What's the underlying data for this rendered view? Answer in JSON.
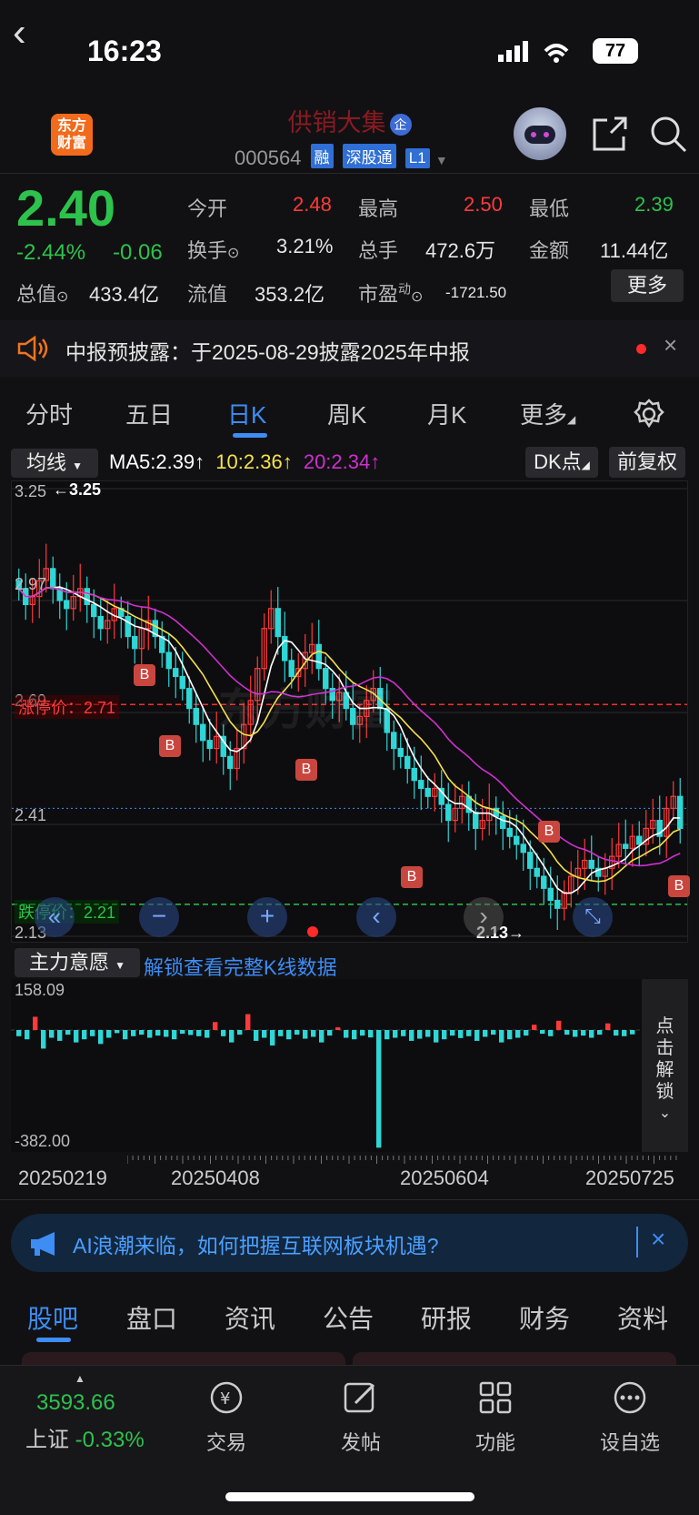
{
  "status": {
    "time": "16:23",
    "battery": "77"
  },
  "header": {
    "stock_name": "供销大集",
    "qi_badge": "企",
    "logo": "东方\n财富",
    "code": "000564",
    "tags": [
      "融",
      "深股通",
      "L1"
    ]
  },
  "quote": {
    "price": "2.40",
    "change_pct": "-2.44%",
    "change": "-0.06",
    "open_label": "今开",
    "open": "2.48",
    "high_label": "最高",
    "high": "2.50",
    "low_label": "最低",
    "low": "2.39",
    "turnover_label": "换手",
    "turnover": "3.21%",
    "volume_label": "总手",
    "volume": "472.6万",
    "amount_label": "金额",
    "amount": "11.44亿",
    "mktcap_label": "总值",
    "mktcap": "433.4亿",
    "float_label": "流值",
    "float": "353.2亿",
    "pe_label": "市盈",
    "pe_sup": "动",
    "pe": "-1721.50",
    "more": "更多"
  },
  "notice": {
    "text": "中报预披露：于2025-08-29披露2025年中报"
  },
  "tabs": [
    "分时",
    "五日",
    "日K",
    "周K",
    "月K",
    "更多"
  ],
  "chart_toolbar": {
    "indicator": "均线",
    "ma5": "MA5:2.39↑",
    "ma10": "10:2.36↑",
    "ma20": "20:2.34↑",
    "dk": "DK点",
    "adjust": "前复权"
  },
  "chart_labels": {
    "top_price": "3.25",
    "top_marker": "←3.25",
    "mid_price_1": "2.97",
    "mid_price_2": "2.69",
    "mid_price_3": "2.41",
    "bottom_price": "2.13",
    "bottom_marker": "2.13→",
    "limit_up": "涨停价：2.71",
    "limit_down": "跌停价：2.21",
    "b_marker": "B",
    "watermark": "东方财富"
  },
  "colors": {
    "up": "#ff3a3a",
    "down": "#2fd6d6",
    "ma5": "#ffffff",
    "ma10": "#f5e14a",
    "ma20": "#d02fd0",
    "accent": "#3d8df5"
  },
  "chart_data": {
    "type": "candlestick",
    "ylim": [
      2.13,
      3.25
    ],
    "y_ticks": [
      3.25,
      2.97,
      2.69,
      2.41,
      2.13
    ],
    "x_ticks": [
      "20250219",
      "20250408",
      "20250604",
      "20250725"
    ],
    "limit_up": 2.71,
    "limit_down": 2.21,
    "close": [
      3.0,
      2.96,
      2.98,
      3.02,
      3.05,
      3.0,
      2.97,
      2.95,
      2.98,
      3.0,
      2.96,
      2.93,
      2.9,
      2.92,
      2.95,
      2.93,
      2.88,
      2.85,
      2.9,
      2.92,
      2.88,
      2.84,
      2.8,
      2.78,
      2.75,
      2.7,
      2.66,
      2.62,
      2.6,
      2.63,
      2.58,
      2.55,
      2.6,
      2.66,
      2.72,
      2.8,
      2.9,
      2.95,
      2.88,
      2.82,
      2.78,
      2.8,
      2.84,
      2.86,
      2.8,
      2.75,
      2.72,
      2.74,
      2.7,
      2.66,
      2.68,
      2.72,
      2.75,
      2.7,
      2.64,
      2.6,
      2.58,
      2.55,
      2.52,
      2.5,
      2.48,
      2.5,
      2.46,
      2.42,
      2.45,
      2.48,
      2.44,
      2.4,
      2.42,
      2.45,
      2.43,
      2.4,
      2.38,
      2.36,
      2.34,
      2.3,
      2.28,
      2.25,
      2.22,
      2.2,
      2.24,
      2.28,
      2.3,
      2.32,
      2.3,
      2.28,
      2.3,
      2.33,
      2.36,
      2.35,
      2.38,
      2.36,
      2.4,
      2.42,
      2.38,
      2.45,
      2.48,
      2.4
    ]
  },
  "volume_panel": {
    "indicator": "主力意愿",
    "unlock_link": "解锁查看完整K线数据",
    "max": "158.09",
    "min": "-382.00",
    "lock_text": "点击解锁",
    "values": [
      -20,
      -30,
      50,
      -60,
      -25,
      -35,
      -15,
      -40,
      -30,
      -20,
      -45,
      -25,
      -10,
      -30,
      -20,
      -15,
      -25,
      -18,
      -22,
      -30,
      -12,
      -16,
      -20,
      -25,
      30,
      -20,
      -40,
      -15,
      60,
      -35,
      -25,
      -50,
      -20,
      -30,
      -15,
      -28,
      -22,
      -40,
      -18,
      10,
      -25,
      -30,
      -18,
      -24,
      -380,
      -30,
      -25,
      -20,
      -35,
      -28,
      -22,
      -40,
      -30,
      -18,
      -26,
      -20,
      -35,
      -22,
      -15,
      -40,
      -30,
      -25,
      -18,
      20,
      -12,
      -20,
      35,
      -15,
      -22,
      -18,
      -25,
      -15,
      25,
      -18,
      -20,
      -14
    ]
  },
  "dates": [
    "20250219",
    "20250408",
    "20250604",
    "20250725"
  ],
  "banner": {
    "text": "AI浪潮来临，如何把握互联网板块机遇?"
  },
  "bottom_tabs": [
    "股吧",
    "盘口",
    "资讯",
    "公告",
    "研报",
    "财务",
    "资料"
  ],
  "nav": {
    "index_value": "3593.66",
    "index_name": "上证",
    "index_change": "-0.33%",
    "items": [
      "交易",
      "发帖",
      "功能",
      "设自选"
    ]
  }
}
